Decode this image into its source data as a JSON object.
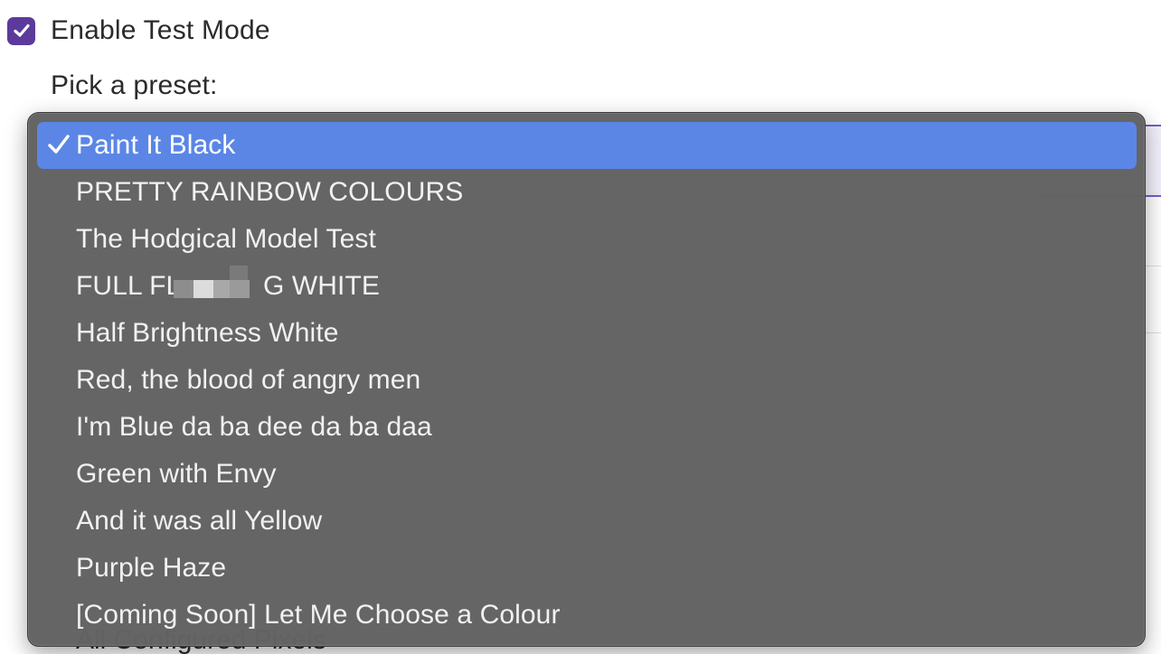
{
  "test_mode": {
    "label": "Enable Test Mode",
    "checked": true,
    "checkbox_color": "#5b3a9c",
    "icon": "checkmark-icon"
  },
  "preset": {
    "label": "Pick a preset:",
    "selected": "Paint It Black",
    "highlight_color": "#5b86e5",
    "options": [
      "Paint It Black",
      "PRETTY RAINBOW COLOURS",
      "The Hodgical Model Test",
      "FULL FL",
      "G WHITE",
      "Half Brightness White",
      "Red, the blood of angry men",
      "I'm Blue da ba dee da ba daa",
      "Green with Envy",
      "And it was all Yellow",
      "Purple Haze",
      "[Coming Soon] Let Me Choose a Colour"
    ]
  },
  "background": {
    "partial_text": "All Configured Pixels"
  }
}
